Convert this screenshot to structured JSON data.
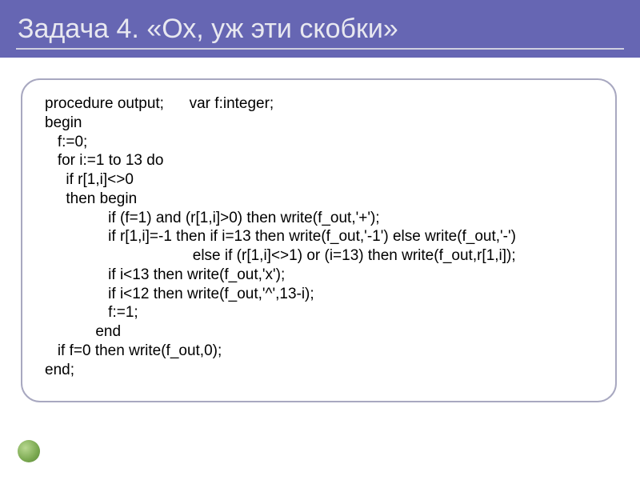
{
  "slide": {
    "title": "Задача 4. «Ох, уж эти скобки»"
  },
  "code": {
    "lines": [
      "procedure output;      var f:integer;",
      "begin",
      "   f:=0;",
      "   for i:=1 to 13 do",
      "     if r[1,i]<>0",
      "     then begin",
      "               if (f=1) and (r[1,i]>0) then write(f_out,'+');",
      "               if r[1,i]=-1 then if i=13 then write(f_out,'-1') else write(f_out,'-')",
      "                                   else if (r[1,i]<>1) or (i=13) then write(f_out,r[1,i]);",
      "               if i<13 then write(f_out,'x');",
      "               if i<12 then write(f_out,'^',13-i);",
      "               f:=1;",
      "            end",
      "   if f=0 then write(f_out,0);",
      "end;"
    ]
  }
}
